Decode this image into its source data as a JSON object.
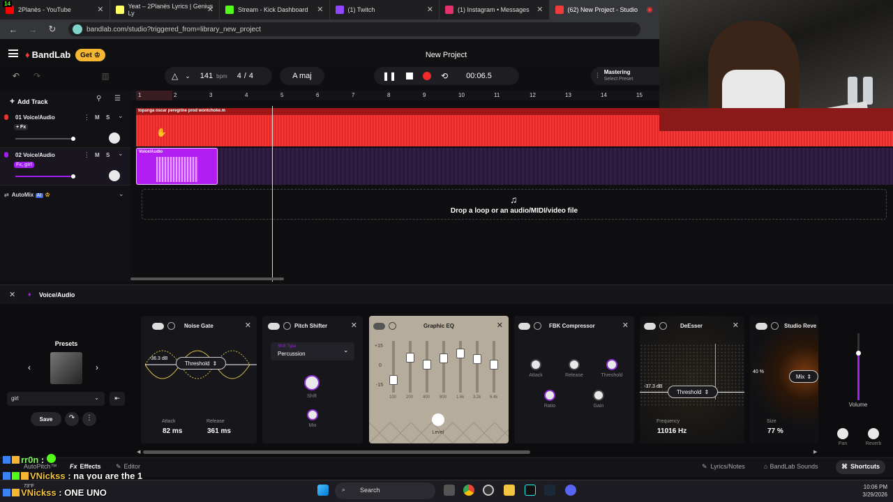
{
  "browser": {
    "tabs": [
      {
        "title": "2Planès - YouTube",
        "color": "#ff0000"
      },
      {
        "title": "Yeat – 2Planès Lyrics | Genius Ly",
        "color": "#ffff64"
      },
      {
        "title": "Stream - Kick Dashboard",
        "color": "#53fc18"
      },
      {
        "title": "(1) Twitch",
        "color": "#9146ff"
      },
      {
        "title": "(1) Instagram • Messages",
        "color": "#e1306c"
      },
      {
        "title": "(62) New Project - Studio",
        "color": "#f23a3a"
      }
    ],
    "url": "bandlab.com/studio?triggered_from=library_new_project",
    "kick_badge": "14"
  },
  "header": {
    "logo": "BandLab",
    "get_label": "Get",
    "project_title": "New Project"
  },
  "toolbar": {
    "bpm_value": "141",
    "bpm_unit": "bpm",
    "time_sig_num": "4",
    "time_sig_slash": "/",
    "time_sig_den": "4",
    "key": "A maj",
    "time": "00:06.5",
    "mastering_title": "Mastering",
    "mastering_sub": "Select Preset"
  },
  "tracks_panel": {
    "add_track": "Add Track",
    "tracks": [
      {
        "num": "01",
        "name": "Voice/Audio",
        "fx": "+ Fx",
        "mute": "M",
        "solo": "S",
        "color": "#e83232"
      },
      {
        "num": "02",
        "name": "Voice/Audio",
        "fx": "Fx, girl",
        "mute": "M",
        "solo": "S",
        "color": "#a21ff0"
      }
    ],
    "automix": "AutoMix",
    "ai": "AI"
  },
  "timeline": {
    "measures": [
      "1",
      "2",
      "3",
      "4",
      "5",
      "6",
      "7",
      "8",
      "9",
      "10",
      "11",
      "12",
      "13",
      "14",
      "15"
    ],
    "clip1_label": "topanga oscar peregrine prod wontchoke.m",
    "clip2_label": "Voice/Audio",
    "drop_text": "Drop a loop or an audio/MIDI/video file"
  },
  "fx_panel": {
    "track_title": "Voice/Audio",
    "presets_label": "Presets",
    "preset_value": "girl",
    "save_label": "Save",
    "noise_gate": {
      "title": "Noise Gate",
      "db": "-36.3 dB",
      "threshold": "Threshold",
      "attack_label": "Attack",
      "attack_value": "82 ms",
      "release_label": "Release",
      "release_value": "361 ms"
    },
    "pitch_shifter": {
      "title": "Pitch Shifter",
      "type_label": "Shift Type",
      "type_value": "Percussion",
      "shift_label": "Shift",
      "mix_label": "Mix"
    },
    "graphic_eq": {
      "title": "Graphic EQ",
      "scale": [
        "+15",
        "0",
        "-15"
      ],
      "bands": [
        "100",
        "200",
        "400",
        "800",
        "1.6k",
        "3.2k",
        "6.4k"
      ],
      "level_label": "Level"
    },
    "fbk_compressor": {
      "title": "FBK Compressor",
      "attack": "Attack",
      "release": "Release",
      "threshold": "Threshold",
      "ratio": "Ratio",
      "gain": "Gain"
    },
    "deesser": {
      "title": "DeEsser",
      "db": "-37.3 dB",
      "threshold": "Threshold",
      "freq_label": "Frequency",
      "freq_value": "11016 Hz"
    },
    "studio_reverb": {
      "title": "Studio Reve",
      "pct": "40 %",
      "mix": "Mix",
      "size_label": "Size",
      "size_value": "77 %"
    },
    "right": {
      "volume": "Volume",
      "pan": "Pan",
      "reverb": "Reverb"
    }
  },
  "bottom": {
    "autopitch": "AutoPitch™",
    "effects": "Effects",
    "editor": "Editor",
    "lyrics": "Lyrics/Notes",
    "sounds": "BandLab Sounds",
    "shortcuts": "Shortcuts"
  },
  "chat": [
    {
      "user": "rr0n",
      "msg": ":"
    },
    {
      "user": "VNickss",
      "msg": ": na you are the 1"
    },
    {
      "user": "VNickss",
      "msg": ": ONE UNO"
    }
  ],
  "taskbar": {
    "search": "Search",
    "weather": "73°F",
    "time": "10:06 PM",
    "date": "3/29/2026"
  }
}
